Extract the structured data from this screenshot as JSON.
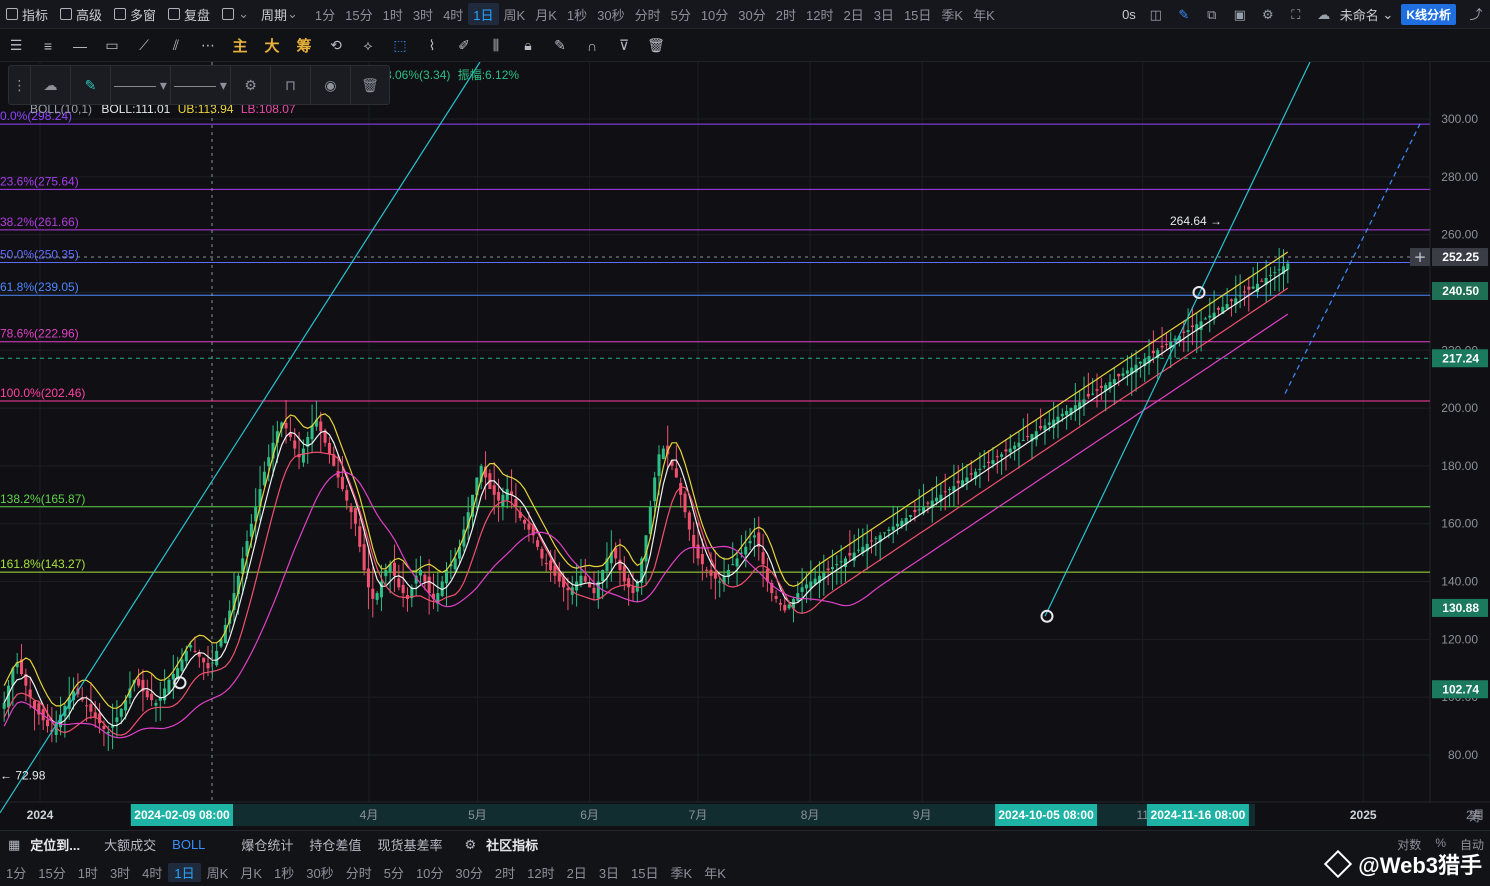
{
  "topbar": {
    "left_items": [
      {
        "label": "指标",
        "icon": "indicator-icon"
      },
      {
        "label": "高级",
        "icon": "advanced-icon"
      },
      {
        "label": "多窗",
        "icon": "multi-window-icon"
      },
      {
        "label": "复盘",
        "icon": "replay-icon"
      },
      {
        "label": "",
        "icon": "candle-type-icon"
      },
      {
        "label": "周期",
        "icon": ""
      }
    ],
    "timeframes": [
      "1分",
      "15分",
      "1时",
      "3时",
      "4时",
      "1日",
      "周K",
      "月K",
      "1秒",
      "30秒",
      "分时",
      "5分",
      "10分",
      "30分",
      "2时",
      "12时",
      "2日",
      "3日",
      "15日",
      "季K",
      "年K"
    ],
    "active_timeframe": "1日",
    "right": {
      "latency": "0s",
      "name": "未命名",
      "analysis_button": "K线分析"
    }
  },
  "drawbar": {
    "gold_labels": [
      "主",
      "大",
      "筹"
    ]
  },
  "legend": {
    "boll_label": "BOLL(10,1)",
    "boll_value": "BOLL:111.01",
    "ub": "UB:113.94",
    "lb": "LB:108.07",
    "change_text": "3.06%(3.34)",
    "amplitude_text": "振幅:6.12%"
  },
  "chart_data": {
    "type": "candlestick",
    "y_range": [
      60,
      310
    ],
    "y_ticks": [
      80,
      100,
      120,
      140,
      160,
      180,
      200,
      220,
      240,
      260,
      280,
      300
    ],
    "x_labels": [
      {
        "label": "2024",
        "day": 0
      },
      {
        "label": "4月",
        "day": 91
      },
      {
        "label": "5月",
        "day": 121
      },
      {
        "label": "6月",
        "day": 152
      },
      {
        "label": "7月",
        "day": 182
      },
      {
        "label": "8月",
        "day": 213
      },
      {
        "label": "9月",
        "day": 244
      },
      {
        "label": "11",
        "day": 305
      },
      {
        "label": "2月",
        "day": 397
      },
      {
        "label": "2025",
        "day": 366
      }
    ],
    "x_highlights": [
      {
        "label": "2024-02-09 08:00",
        "day": 39
      },
      {
        "label": "2024-10-05 08:00",
        "day": 278
      },
      {
        "label": "2024-11-16 08:00",
        "day": 320
      }
    ],
    "fib_levels": [
      {
        "label": "0.0%(298.24)",
        "price": 298.24,
        "color": "#8e44ff"
      },
      {
        "label": "23.6%(275.64)",
        "price": 275.64,
        "color": "#a83cf0"
      },
      {
        "label": "38.2%(261.66)",
        "price": 261.66,
        "color": "#b33be0"
      },
      {
        "label": "50.0%(250.35)",
        "price": 250.35,
        "color": "#5f6cff"
      },
      {
        "label": "61.8%(239.05)",
        "price": 239.05,
        "color": "#4e88ff"
      },
      {
        "label": "78.6%(222.96)",
        "price": 222.96,
        "color": "#e040c8"
      },
      {
        "label": "100.0%(202.46)",
        "price": 202.46,
        "color": "#ff40a0"
      },
      {
        "label": "138.2%(165.87)",
        "price": 165.87,
        "color": "#5fd34a"
      },
      {
        "label": "161.8%(143.27)",
        "price": 143.27,
        "color": "#a6e23a"
      }
    ],
    "price_tags": [
      {
        "label": "252.25",
        "price": 252.25,
        "color": "#3a3d46"
      },
      {
        "label": "240.50",
        "price": 240.5,
        "color": "#1f6f55"
      },
      {
        "label": "217.24",
        "price": 217.24,
        "color": "#1b7a5e"
      },
      {
        "label": "130.88",
        "price": 130.88,
        "color": "#1b7a5e"
      },
      {
        "label": "102.74",
        "price": 102.74,
        "color": "#1b7a5e"
      }
    ],
    "high_label": {
      "text": "264.64 →",
      "price": 264.64,
      "day": 318
    },
    "low_label": {
      "text": "← 72.98",
      "price": 72.98,
      "day": 0
    },
    "closes": [
      98,
      104,
      110,
      112,
      108,
      104,
      100,
      96,
      94,
      92,
      90,
      88,
      91,
      94,
      97,
      100,
      102,
      101,
      99,
      97,
      95,
      93,
      91,
      89,
      88,
      90,
      93,
      96,
      99,
      103,
      106,
      104,
      102,
      100,
      99,
      98,
      100,
      103,
      106,
      108,
      110,
      113,
      116,
      118,
      116,
      114,
      112,
      110,
      112,
      116,
      120,
      125,
      130,
      136,
      142,
      148,
      154,
      160,
      166,
      172,
      178,
      183,
      188,
      192,
      195,
      193,
      190,
      186,
      183,
      186,
      190,
      194,
      196,
      192,
      188,
      184,
      180,
      176,
      172,
      168,
      164,
      160,
      152,
      144,
      138,
      134,
      136,
      140,
      144,
      146,
      142,
      138,
      136,
      134,
      138,
      142,
      144,
      140,
      136,
      134,
      136,
      140,
      144,
      146,
      148,
      152,
      158,
      164,
      170,
      176,
      180,
      176,
      172,
      170,
      168,
      170,
      172,
      170,
      166,
      162,
      160,
      158,
      156,
      152,
      148,
      146,
      144,
      142,
      140,
      138,
      137,
      138,
      140,
      142,
      140,
      138,
      136,
      140,
      144,
      148,
      150,
      148,
      144,
      140,
      138,
      136,
      140,
      148,
      156,
      166,
      176,
      184,
      186,
      184,
      180,
      176,
      170,
      164,
      158,
      152,
      148,
      146,
      144,
      142,
      141,
      140,
      142,
      144,
      146,
      148,
      150,
      152,
      154,
      156,
      152,
      146,
      140,
      136,
      134,
      132,
      130,
      132,
      134,
      136,
      138,
      139,
      140,
      141,
      142,
      143,
      144,
      145,
      146,
      147,
      148,
      149,
      150,
      151,
      152,
      153,
      154,
      155,
      156,
      157,
      158,
      159,
      160,
      161,
      162,
      163,
      164,
      165,
      166,
      167,
      168,
      169,
      170,
      171,
      172,
      173,
      174,
      175,
      176,
      177,
      178,
      179,
      180,
      181,
      182,
      183,
      184,
      185,
      186,
      187,
      188,
      189,
      190,
      191,
      192,
      193,
      194,
      195,
      196,
      197,
      198,
      199,
      200,
      201,
      202,
      203,
      204,
      205,
      206,
      207,
      208,
      209,
      210,
      211,
      212,
      213,
      214,
      215,
      216,
      217,
      218,
      219,
      220,
      221,
      222,
      223,
      224,
      225,
      226,
      227,
      228,
      229,
      230,
      231,
      232,
      233,
      234,
      235,
      236,
      237,
      238,
      239,
      240,
      241,
      242,
      243,
      244,
      245,
      246,
      247,
      248,
      249,
      250
    ]
  },
  "indicator_bar": {
    "items": [
      "定位到...",
      "大额成交",
      "BOLL",
      "爆仓统计",
      "持仓差值",
      "现货基差率",
      "社区指标"
    ],
    "scale_options": [
      "对数",
      "%",
      "自动"
    ]
  },
  "bottom_timeframes": [
    "1分",
    "15分",
    "1时",
    "3时",
    "4时",
    "1日",
    "周K",
    "月K",
    "1秒",
    "30秒",
    "分时",
    "5分",
    "10分",
    "30分",
    "2时",
    "12时",
    "2日",
    "3日",
    "15日",
    "季K",
    "年K"
  ],
  "bottom_active": "1日",
  "watermark": "@Web3猎手",
  "corner_label": "筹"
}
